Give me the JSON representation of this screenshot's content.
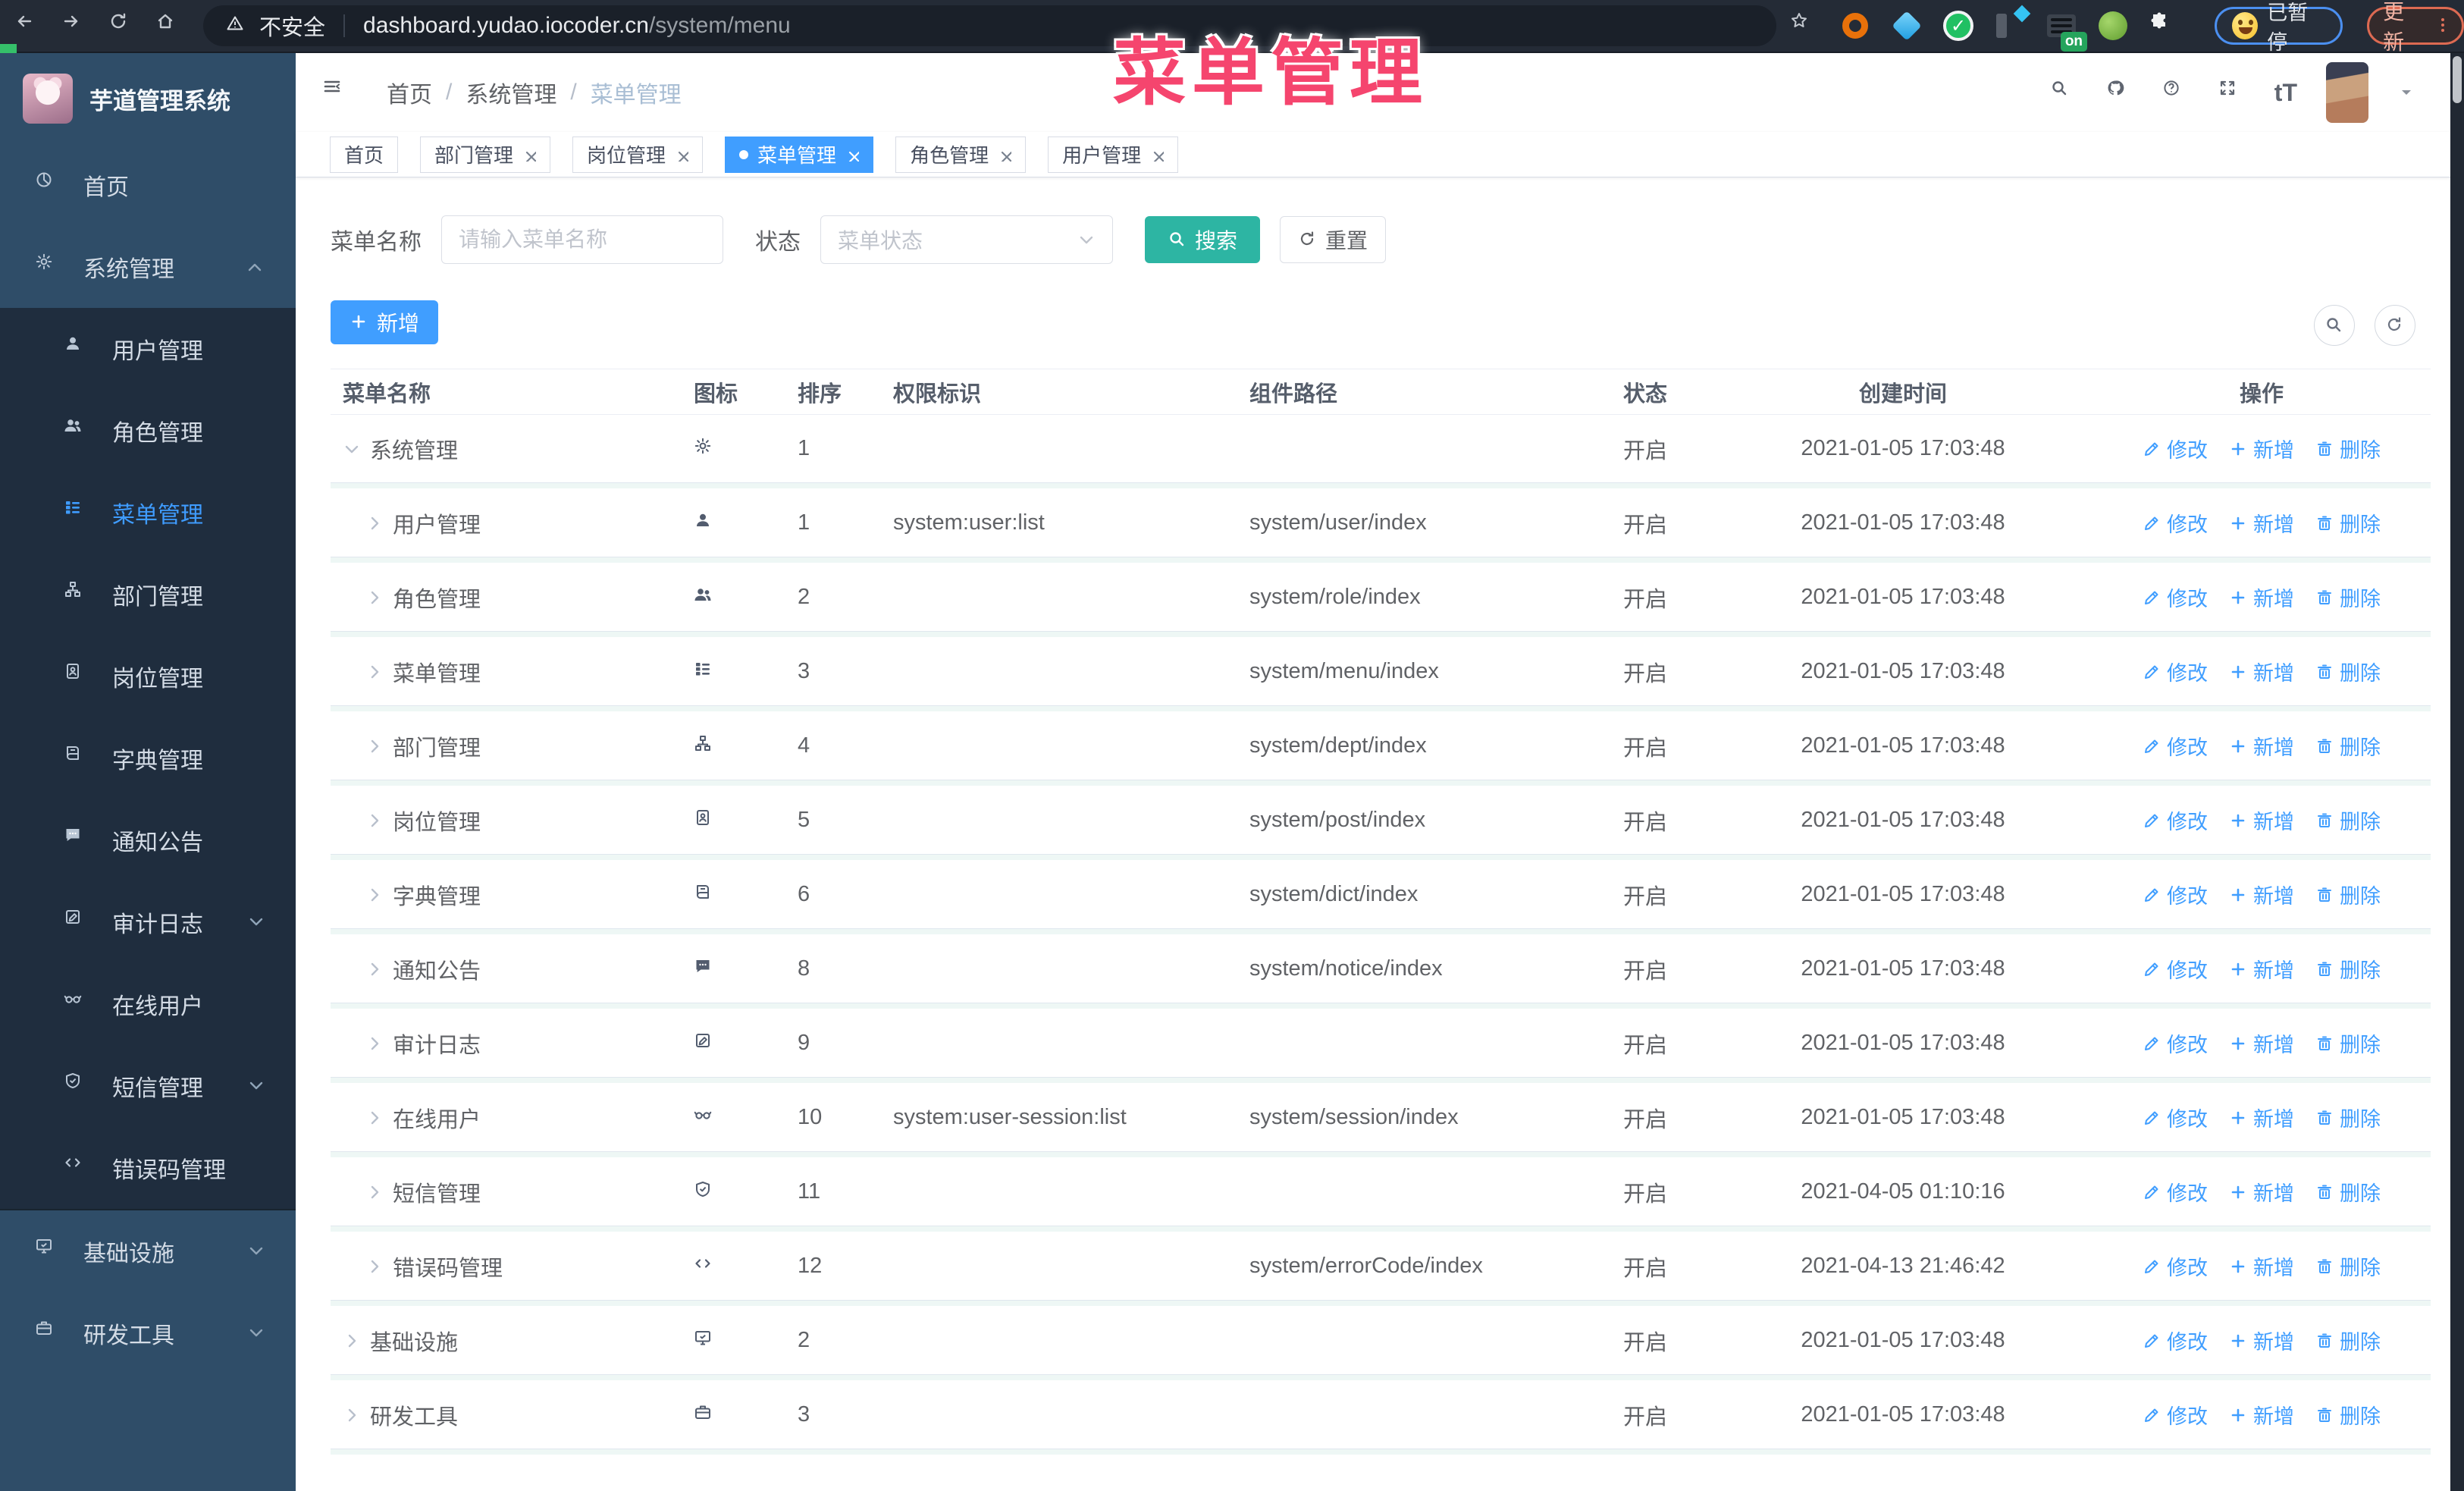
{
  "colors": {
    "accent": "#409eff",
    "search_button_teal": "#2db5a3",
    "overlay_pink": "#f5456e",
    "sidebar_bg": "#2f4d68",
    "sidebar_submenu_bg": "#1f2d3e",
    "status_text": "#606266"
  },
  "overlay_title": "菜单管理",
  "browser": {
    "nav_icons": [
      "back",
      "forward",
      "reload",
      "home"
    ],
    "security_label": "不安全",
    "url_host": "dashboard.yudao.iocoder.cn",
    "url_path": "/system/menu",
    "bookmark_icon": "star",
    "extensions": [
      "orange-ring",
      "blue-gem",
      "green-check",
      "columns",
      "rows-on",
      "frog",
      "puzzle"
    ],
    "on_badge_label": "on",
    "paused_label": "已暂停",
    "update_label": "更新"
  },
  "sidebar": {
    "app_title": "芋道管理系统",
    "items": [
      {
        "label": "首页",
        "icon": "pie",
        "type": "top"
      },
      {
        "label": "系统管理",
        "icon": "gear",
        "type": "top",
        "chevron": "up"
      },
      {
        "label": "用户管理",
        "icon": "user",
        "type": "sub"
      },
      {
        "label": "角色管理",
        "icon": "users",
        "type": "sub"
      },
      {
        "label": "菜单管理",
        "icon": "tree-table",
        "type": "sub",
        "active": true
      },
      {
        "label": "部门管理",
        "icon": "org",
        "type": "sub"
      },
      {
        "label": "岗位管理",
        "icon": "badge",
        "type": "sub"
      },
      {
        "label": "字典管理",
        "icon": "book",
        "type": "sub"
      },
      {
        "label": "通知公告",
        "icon": "chat",
        "type": "sub"
      },
      {
        "label": "审计日志",
        "icon": "edit-doc",
        "type": "sub",
        "chevron": "down"
      },
      {
        "label": "在线用户",
        "icon": "goggles",
        "type": "sub"
      },
      {
        "label": "短信管理",
        "icon": "shield",
        "type": "sub",
        "chevron": "down"
      },
      {
        "label": "错误码管理",
        "icon": "code",
        "type": "sub"
      },
      {
        "label": "基础设施",
        "icon": "monitor",
        "type": "top",
        "chevron": "down"
      },
      {
        "label": "研发工具",
        "icon": "briefcase",
        "type": "top",
        "chevron": "down"
      }
    ]
  },
  "header": {
    "hamburger_icon": "menu",
    "breadcrumb": [
      "首页",
      "系统管理",
      "菜单管理"
    ],
    "action_icons": [
      "search",
      "github",
      "help",
      "fullscreen"
    ],
    "font_size_icon_label": "tT"
  },
  "tabs": [
    {
      "label": "首页",
      "closable": false,
      "active": false
    },
    {
      "label": "部门管理",
      "closable": true,
      "active": false
    },
    {
      "label": "岗位管理",
      "closable": true,
      "active": false
    },
    {
      "label": "菜单管理",
      "closable": true,
      "active": true
    },
    {
      "label": "角色管理",
      "closable": true,
      "active": false
    },
    {
      "label": "用户管理",
      "closable": true,
      "active": false
    }
  ],
  "filters": {
    "name_label": "菜单名称",
    "name_placeholder": "请输入菜单名称",
    "status_label": "状态",
    "status_placeholder": "菜单状态",
    "search_label": "搜索",
    "reset_label": "重置"
  },
  "toolbar": {
    "add_label": "新增",
    "icon_buttons": [
      "search",
      "refresh"
    ]
  },
  "table": {
    "columns": [
      "菜单名称",
      "图标",
      "排序",
      "权限标识",
      "组件路径",
      "状态",
      "创建时间",
      "操作"
    ],
    "row_actions": [
      {
        "label": "修改",
        "icon": "edit"
      },
      {
        "label": "新增",
        "icon": "plus"
      },
      {
        "label": "删除",
        "icon": "trash"
      }
    ],
    "rows": [
      {
        "name": "系统管理",
        "icon": "gear",
        "level": 0,
        "expanded": true,
        "order": "1",
        "perm": "",
        "path": "",
        "status": "开启",
        "created": "2021-01-05 17:03:48"
      },
      {
        "name": "用户管理",
        "icon": "user",
        "level": 1,
        "expanded": false,
        "order": "1",
        "perm": "system:user:list",
        "path": "system/user/index",
        "status": "开启",
        "created": "2021-01-05 17:03:48"
      },
      {
        "name": "角色管理",
        "icon": "users",
        "level": 1,
        "expanded": false,
        "order": "2",
        "perm": "",
        "path": "system/role/index",
        "status": "开启",
        "created": "2021-01-05 17:03:48"
      },
      {
        "name": "菜单管理",
        "icon": "tree-table",
        "level": 1,
        "expanded": false,
        "order": "3",
        "perm": "",
        "path": "system/menu/index",
        "status": "开启",
        "created": "2021-01-05 17:03:48"
      },
      {
        "name": "部门管理",
        "icon": "org",
        "level": 1,
        "expanded": false,
        "order": "4",
        "perm": "",
        "path": "system/dept/index",
        "status": "开启",
        "created": "2021-01-05 17:03:48"
      },
      {
        "name": "岗位管理",
        "icon": "badge",
        "level": 1,
        "expanded": false,
        "order": "5",
        "perm": "",
        "path": "system/post/index",
        "status": "开启",
        "created": "2021-01-05 17:03:48"
      },
      {
        "name": "字典管理",
        "icon": "book",
        "level": 1,
        "expanded": false,
        "order": "6",
        "perm": "",
        "path": "system/dict/index",
        "status": "开启",
        "created": "2021-01-05 17:03:48"
      },
      {
        "name": "通知公告",
        "icon": "chat",
        "level": 1,
        "expanded": false,
        "order": "8",
        "perm": "",
        "path": "system/notice/index",
        "status": "开启",
        "created": "2021-01-05 17:03:48"
      },
      {
        "name": "审计日志",
        "icon": "edit-doc",
        "level": 1,
        "expanded": false,
        "order": "9",
        "perm": "",
        "path": "",
        "status": "开启",
        "created": "2021-01-05 17:03:48"
      },
      {
        "name": "在线用户",
        "icon": "goggles",
        "level": 1,
        "expanded": false,
        "order": "10",
        "perm": "system:user-session:list",
        "path": "system/session/index",
        "status": "开启",
        "created": "2021-01-05 17:03:48"
      },
      {
        "name": "短信管理",
        "icon": "shield",
        "level": 1,
        "expanded": false,
        "order": "11",
        "perm": "",
        "path": "",
        "status": "开启",
        "created": "2021-04-05 01:10:16"
      },
      {
        "name": "错误码管理",
        "icon": "code",
        "level": 1,
        "expanded": false,
        "order": "12",
        "perm": "",
        "path": "system/errorCode/index",
        "status": "开启",
        "created": "2021-04-13 21:46:42"
      },
      {
        "name": "基础设施",
        "icon": "monitor",
        "level": 0,
        "expanded": false,
        "order": "2",
        "perm": "",
        "path": "",
        "status": "开启",
        "created": "2021-01-05 17:03:48"
      },
      {
        "name": "研发工具",
        "icon": "briefcase",
        "level": 0,
        "expanded": false,
        "order": "3",
        "perm": "",
        "path": "",
        "status": "开启",
        "created": "2021-01-05 17:03:48"
      }
    ]
  }
}
